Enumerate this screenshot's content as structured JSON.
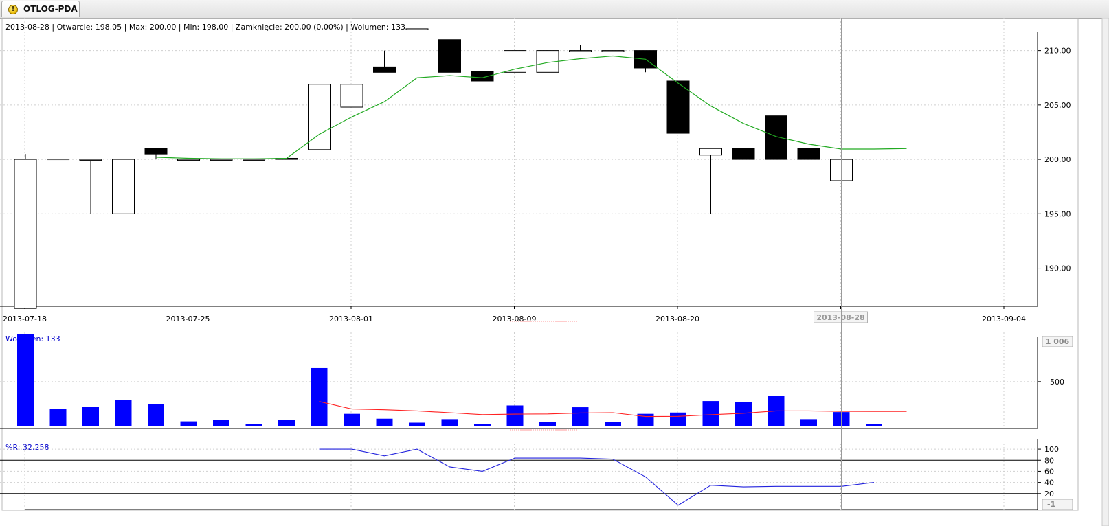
{
  "tab": {
    "title": "OTLOG-PDA",
    "icon": "warning-icon"
  },
  "colors": {
    "candle_up": "#ffffff",
    "candle_down": "#000000",
    "ma_price": "#22aa22",
    "volume_bar": "#0000ff",
    "volume_ma": "#ff2222",
    "wr_line": "#2222dd",
    "label_blue": "#0000cc"
  },
  "chart_data": [
    {
      "type": "candlestick",
      "info_line": "2013-08-28 | Otwarcie: 198,05 | Max: 200,00 | Min: 198,00 | Zamknięcie: 200,00 (0,00%)  | Wolumen: 133",
      "ylim": [
        186.5,
        212.5
      ],
      "y_ticks": [
        210,
        205,
        200,
        195,
        190
      ],
      "y_tick_labels": [
        "210,00",
        "205,00",
        "200,00",
        "195,00",
        "190,00"
      ],
      "x_ticks": [
        "2013-07-18",
        "2013-07-25",
        "2013-08-01",
        "2013-08-09",
        "2013-08-20",
        "2013-08-28",
        "2013-09-04"
      ],
      "x_tick_index": [
        0,
        5,
        10,
        15,
        20,
        25,
        30
      ],
      "highlighted_x_tick": "2013-08-28",
      "crosshair_index": 25,
      "candles": [
        {
          "o": 186.3,
          "h": 200.5,
          "l": 186.3,
          "c": 200.0
        },
        {
          "o": 199.85,
          "h": 200.0,
          "l": 199.85,
          "c": 200.0
        },
        {
          "o": 200.0,
          "h": 200.0,
          "l": 195.0,
          "c": 200.0
        },
        {
          "o": 195.0,
          "h": 200.0,
          "l": 195.0,
          "c": 200.0
        },
        {
          "o": 201.0,
          "h": 201.0,
          "l": 200.0,
          "c": 200.5
        },
        {
          "o": 200.0,
          "h": 200.0,
          "l": 200.0,
          "c": 200.0
        },
        {
          "o": 200.0,
          "h": 200.0,
          "l": 200.0,
          "c": 200.0
        },
        {
          "o": 200.0,
          "h": 200.0,
          "l": 200.0,
          "c": 200.0
        },
        {
          "o": 200.0,
          "h": 200.1,
          "l": 200.0,
          "c": 200.1
        },
        {
          "o": 200.9,
          "h": 206.9,
          "l": 200.9,
          "c": 206.9
        },
        {
          "o": 204.8,
          "h": 206.9,
          "l": 204.8,
          "c": 206.9
        },
        {
          "o": 208.5,
          "h": 210.0,
          "l": 208.0,
          "c": 208.0
        },
        {
          "o": 212.0,
          "h": 212.0,
          "l": 212.0,
          "c": 212.0
        },
        {
          "o": 211.0,
          "h": 211.0,
          "l": 208.0,
          "c": 208.0
        },
        {
          "o": 208.1,
          "h": 208.1,
          "l": 207.2,
          "c": 207.2
        },
        {
          "o": 208.0,
          "h": 210.0,
          "l": 208.0,
          "c": 210.0
        },
        {
          "o": 208.0,
          "h": 210.0,
          "l": 208.0,
          "c": 210.0
        },
        {
          "o": 210.0,
          "h": 210.5,
          "l": 210.0,
          "c": 210.0
        },
        {
          "o": 210.0,
          "h": 210.0,
          "l": 210.0,
          "c": 210.0
        },
        {
          "o": 210.0,
          "h": 210.0,
          "l": 208.0,
          "c": 208.4
        },
        {
          "o": 207.2,
          "h": 207.2,
          "l": 202.4,
          "c": 202.4
        },
        {
          "o": 200.4,
          "h": 201.0,
          "l": 195.0,
          "c": 201.0
        },
        {
          "o": 201.0,
          "h": 201.0,
          "l": 200.0,
          "c": 200.0
        },
        {
          "o": 204.0,
          "h": 204.0,
          "l": 200.0,
          "c": 200.0
        },
        {
          "o": 201.0,
          "h": 201.0,
          "l": 200.0,
          "c": 200.0
        },
        {
          "o": 198.05,
          "h": 200.0,
          "l": 198.0,
          "c": 200.0
        }
      ],
      "ma_start_index": 4,
      "ma_values": [
        200.2,
        200.1,
        200.05,
        200.05,
        200.1,
        202.3,
        203.9,
        205.3,
        207.5,
        207.7,
        207.5,
        208.3,
        208.9,
        209.25,
        209.5,
        209.2,
        207.0,
        204.9,
        203.3,
        202.1,
        201.4,
        200.95,
        200.95,
        201.0
      ]
    },
    {
      "type": "bar",
      "label": "Wolumen: 133",
      "ylim": [
        0,
        1060
      ],
      "y_ticks": [
        500
      ],
      "y_tick_labels": [
        "500"
      ],
      "boxed_value_label": "1 006",
      "values": [
        1090,
        190,
        215,
        295,
        245,
        50,
        65,
        22,
        65,
        655,
        135,
        80,
        35,
        75,
        20,
        230,
        40,
        210,
        40,
        135,
        150,
        280,
        270,
        340,
        75,
        155,
        20
      ],
      "ma_start_index": 9,
      "ma_values": [
        275,
        190,
        182,
        168,
        148,
        126,
        132,
        134,
        145,
        148,
        105,
        107,
        125,
        142,
        168,
        168,
        163,
        162,
        162
      ]
    },
    {
      "type": "line",
      "label": "%R: 32,258",
      "ylim": [
        -5,
        110
      ],
      "y_ticks": [
        100,
        80,
        60,
        40,
        20
      ],
      "y_tick_labels": [
        "100",
        "80",
        "60",
        "40",
        "20"
      ],
      "reference_lines": [
        80,
        20
      ],
      "boxed_value_label": "-1",
      "start_index": 9,
      "values": [
        100,
        100,
        88,
        100,
        68,
        60,
        84,
        84,
        84,
        82,
        50,
        -1,
        35,
        32,
        33,
        33,
        33,
        40
      ]
    }
  ]
}
